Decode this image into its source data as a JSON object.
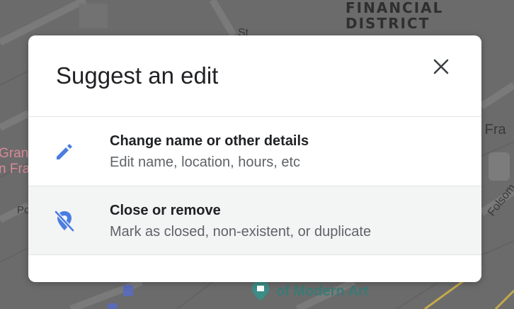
{
  "map": {
    "district_label_line1": "FINANCIAL",
    "district_label_line2": "DISTRICT",
    "left_poi_line1": "Grand",
    "left_poi_line2": "n Fra",
    "left_text": "Po",
    "right_text": "n Fra",
    "street_label": "Folsom",
    "museum_label": "of Modern Art",
    "street_fragment": "St"
  },
  "dialog": {
    "title": "Suggest an edit",
    "close_icon": "close-icon",
    "options": [
      {
        "icon": "pencil-icon",
        "title": "Change name or other details",
        "subtitle": "Edit name, location, hours, etc"
      },
      {
        "icon": "location-off-icon",
        "title": "Close or remove",
        "subtitle": "Mark as closed, non-existent, or duplicate"
      }
    ]
  },
  "colors": {
    "accent_blue": "#4a7de2",
    "title_text": "#202124",
    "secondary_text": "#5f6368",
    "highlight_row": "#f3f4f4"
  }
}
